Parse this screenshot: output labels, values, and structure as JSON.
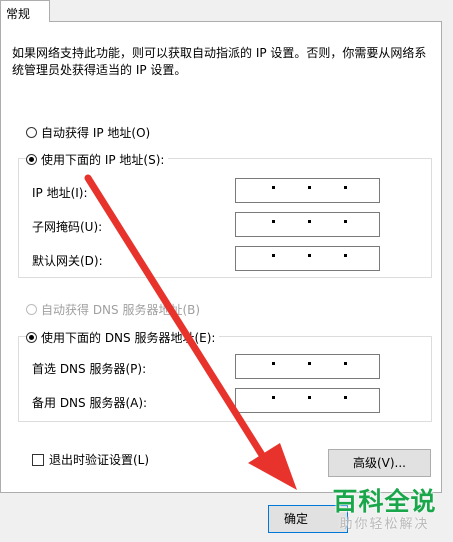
{
  "tab": {
    "label": "常规"
  },
  "description": "如果网络支持此功能，则可以获取自动指派的 IP 设置。否则，你需要从网络系统管理员处获得适当的 IP 设置。",
  "ip": {
    "auto_label": "自动获得 IP 地址(O)",
    "manual_label": "使用下面的 IP 地址(S):",
    "fields": [
      {
        "label": "IP 地址(I):"
      },
      {
        "label": "子网掩码(U):"
      },
      {
        "label": "默认网关(D):"
      }
    ]
  },
  "dns": {
    "auto_label": "自动获得 DNS 服务器地址(B)",
    "manual_label": "使用下面的 DNS 服务器地址(E):",
    "fields": [
      {
        "label": "首选 DNS 服务器(P):"
      },
      {
        "label": "备用 DNS 服务器(A):"
      }
    ]
  },
  "validate_label": "退出时验证设置(L)",
  "advanced_button": "高级(V)...",
  "ok_button": "确定",
  "watermark": {
    "title": "百科全说",
    "subtitle": "助你轻松解决"
  },
  "colors": {
    "arrow": "#e8332c",
    "watermark_green": "#1aa64a"
  }
}
